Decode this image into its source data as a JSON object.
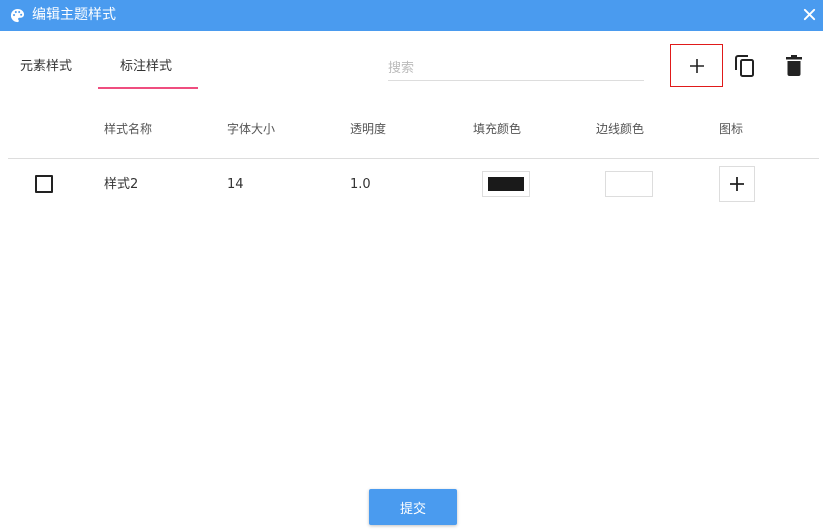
{
  "title": "编辑主题样式",
  "tabs": [
    {
      "label": "元素样式",
      "active": false
    },
    {
      "label": "标注样式",
      "active": true
    }
  ],
  "search": {
    "placeholder": "搜索",
    "value": ""
  },
  "toolbar": {
    "add_icon": "plus-icon",
    "copy_icon": "copy-icon",
    "delete_icon": "trash-icon"
  },
  "table": {
    "columns": [
      "样式名称",
      "字体大小",
      "透明度",
      "填充颜色",
      "边线颜色",
      "图标"
    ],
    "rows": [
      {
        "checked": false,
        "name": "样式2",
        "font_size": "14",
        "opacity": "1.0",
        "fill_color": "#1a1a1a",
        "border_color": "#ffffff",
        "icon": "plus-icon"
      }
    ]
  },
  "submit_label": "提交",
  "colors": {
    "accent": "#4a9bef",
    "tab_underline": "#ef4d7f",
    "highlight_border": "#e01a1a"
  }
}
